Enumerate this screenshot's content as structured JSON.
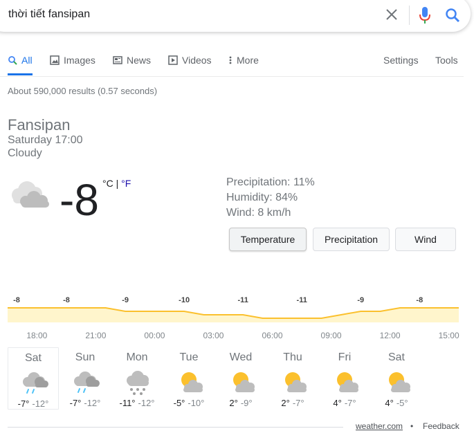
{
  "search": {
    "query": "thời tiết fansipan"
  },
  "tabs": [
    {
      "label": "All",
      "icon": "search-icon"
    },
    {
      "label": "Images",
      "icon": "image-icon"
    },
    {
      "label": "News",
      "icon": "news-icon"
    },
    {
      "label": "Videos",
      "icon": "video-icon"
    },
    {
      "label": "More",
      "icon": "more-vert-icon"
    }
  ],
  "tools": {
    "settings": "Settings",
    "tools": "Tools"
  },
  "result_stats": "About 590,000 results (0.57 seconds)",
  "weather": {
    "location": "Fansipan",
    "datetime": "Saturday 17:00",
    "condition": "Cloudy",
    "temperature": "-8",
    "unit_c": "°C",
    "unit_sep": " | ",
    "unit_f": "°F",
    "precipitation": "Precipitation: 11%",
    "humidity": "Humidity: 84%",
    "wind": "Wind: 8 km/h",
    "buttons": {
      "temperature": "Temperature",
      "precipitation": "Precipitation",
      "wind": "Wind"
    }
  },
  "chart_data": {
    "type": "area",
    "title": "",
    "x": [
      "17:00",
      "18:00",
      "19:00",
      "20:00",
      "21:00",
      "22:00",
      "23:00",
      "00:00",
      "01:00",
      "02:00",
      "03:00",
      "04:00",
      "05:00",
      "06:00",
      "07:00",
      "08:00",
      "09:00",
      "10:00",
      "11:00",
      "12:00",
      "13:00",
      "14:00",
      "15:00",
      "16:00"
    ],
    "values": [
      -8,
      -8,
      -8,
      -8,
      -8,
      -8,
      -9,
      -9,
      -9,
      -9,
      -10,
      -10,
      -10,
      -11,
      -11,
      -11,
      -11,
      -10,
      -9,
      -9,
      -8,
      -8,
      -8,
      -8
    ],
    "point_labels": [
      {
        "x": "17:00",
        "label": "-8"
      },
      {
        "x": "20:00",
        "label": "-8"
      },
      {
        "x": "23:00",
        "label": "-9"
      },
      {
        "x": "02:00",
        "label": "-10"
      },
      {
        "x": "05:00",
        "label": "-11"
      },
      {
        "x": "08:00",
        "label": "-11"
      },
      {
        "x": "11:00",
        "label": "-9"
      },
      {
        "x": "14:00",
        "label": "-8"
      }
    ],
    "tick_labels": [
      "18:00",
      "21:00",
      "00:00",
      "03:00",
      "06:00",
      "09:00",
      "12:00",
      "15:00"
    ],
    "line_color": "#fbc02d",
    "fill_color": "#fff5cc"
  },
  "forecast": [
    {
      "day": "Sat",
      "hi": "-7°",
      "lo": "-12°",
      "icon": "rain-cloud-icon"
    },
    {
      "day": "Sun",
      "hi": "-7°",
      "lo": "-12°",
      "icon": "rain-cloud-icon"
    },
    {
      "day": "Mon",
      "hi": "-11°",
      "lo": "-12°",
      "icon": "snow-cloud-icon"
    },
    {
      "day": "Tue",
      "hi": "-5°",
      "lo": "-10°",
      "icon": "partly-sunny-icon"
    },
    {
      "day": "Wed",
      "hi": "2°",
      "lo": "-9°",
      "icon": "partly-sunny-icon"
    },
    {
      "day": "Thu",
      "hi": "2°",
      "lo": "-7°",
      "icon": "partly-sunny-icon"
    },
    {
      "day": "Fri",
      "hi": "4°",
      "lo": "-7°",
      "icon": "partly-sunny-icon"
    },
    {
      "day": "Sat",
      "hi": "4°",
      "lo": "-5°",
      "icon": "partly-sunny-icon"
    }
  ],
  "footer": {
    "source": "weather.com",
    "sep": "•",
    "feedback": "Feedback"
  }
}
